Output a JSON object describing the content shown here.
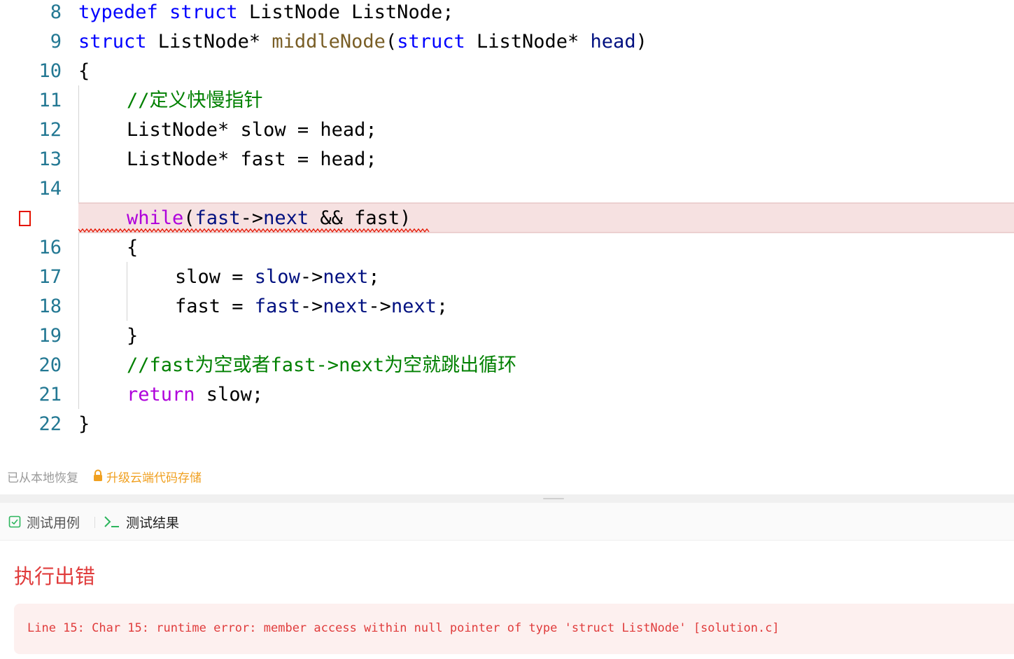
{
  "editor": {
    "lines": [
      {
        "no": "8",
        "tokens": [
          {
            "t": "typedef",
            "c": "kw"
          },
          {
            "t": " "
          },
          {
            "t": "struct",
            "c": "kw"
          },
          {
            "t": " ListNode ListNode;"
          }
        ]
      },
      {
        "no": "9",
        "tokens": [
          {
            "t": "struct",
            "c": "kw"
          },
          {
            "t": " ListNode* "
          },
          {
            "t": "middleNode",
            "c": "fn"
          },
          {
            "t": "("
          },
          {
            "t": "struct",
            "c": "kw"
          },
          {
            "t": " ListNode* "
          },
          {
            "t": "head",
            "c": "var"
          },
          {
            "t": ")"
          }
        ]
      },
      {
        "no": "10",
        "tokens": [
          {
            "t": "{"
          }
        ]
      },
      {
        "no": "11",
        "tokens": [
          {
            "t": "//定义快慢指针",
            "c": "cm"
          }
        ]
      },
      {
        "no": "12",
        "tokens": [
          {
            "t": "ListNode* slow = head;"
          }
        ]
      },
      {
        "no": "13",
        "tokens": [
          {
            "t": "ListNode* fast = head;"
          }
        ]
      },
      {
        "no": "14",
        "tokens": []
      },
      {
        "no": "",
        "error": true,
        "tokens": [
          {
            "t": "while",
            "c": "ctl"
          },
          {
            "t": "("
          },
          {
            "t": "fast",
            "c": "var"
          },
          {
            "t": "->"
          },
          {
            "t": "next",
            "c": "var"
          },
          {
            "t": " && fast)"
          }
        ]
      },
      {
        "no": "16",
        "tokens": [
          {
            "t": "{"
          }
        ]
      },
      {
        "no": "17",
        "tokens": [
          {
            "t": "slow = "
          },
          {
            "t": "slow",
            "c": "var"
          },
          {
            "t": "->"
          },
          {
            "t": "next",
            "c": "var"
          },
          {
            "t": ";"
          }
        ]
      },
      {
        "no": "18",
        "tokens": [
          {
            "t": "fast = "
          },
          {
            "t": "fast",
            "c": "var"
          },
          {
            "t": "->"
          },
          {
            "t": "next",
            "c": "var"
          },
          {
            "t": "->"
          },
          {
            "t": "next",
            "c": "var"
          },
          {
            "t": ";"
          }
        ]
      },
      {
        "no": "19",
        "tokens": [
          {
            "t": "}"
          }
        ]
      },
      {
        "no": "20",
        "tokens": [
          {
            "t": "//fast为空或者fast->next为空就跳出循环",
            "c": "cm"
          }
        ]
      },
      {
        "no": "21",
        "tokens": [
          {
            "t": "return",
            "c": "ctl"
          },
          {
            "t": " slow;"
          }
        ]
      },
      {
        "no": "22",
        "tokens": [
          {
            "t": "}"
          }
        ]
      }
    ]
  },
  "restore": {
    "status": "已从本地恢复",
    "upgrade_label": "升级云端代码存储",
    "lock_icon": "lock-icon"
  },
  "tabs": {
    "test_cases": "测试用例",
    "test_results": "测试结果"
  },
  "result": {
    "status": "执行出错",
    "message": "Line 15: Char 15: runtime error: member access within null pointer of type 'struct ListNode' [solution.c]"
  },
  "colors": {
    "keyword": "#0000ff",
    "control": "#af00db",
    "function": "#795e26",
    "variable": "#001080",
    "comment": "#008000",
    "line_number": "#237893",
    "error": "#e03c3c",
    "accent": "#f0a020"
  }
}
